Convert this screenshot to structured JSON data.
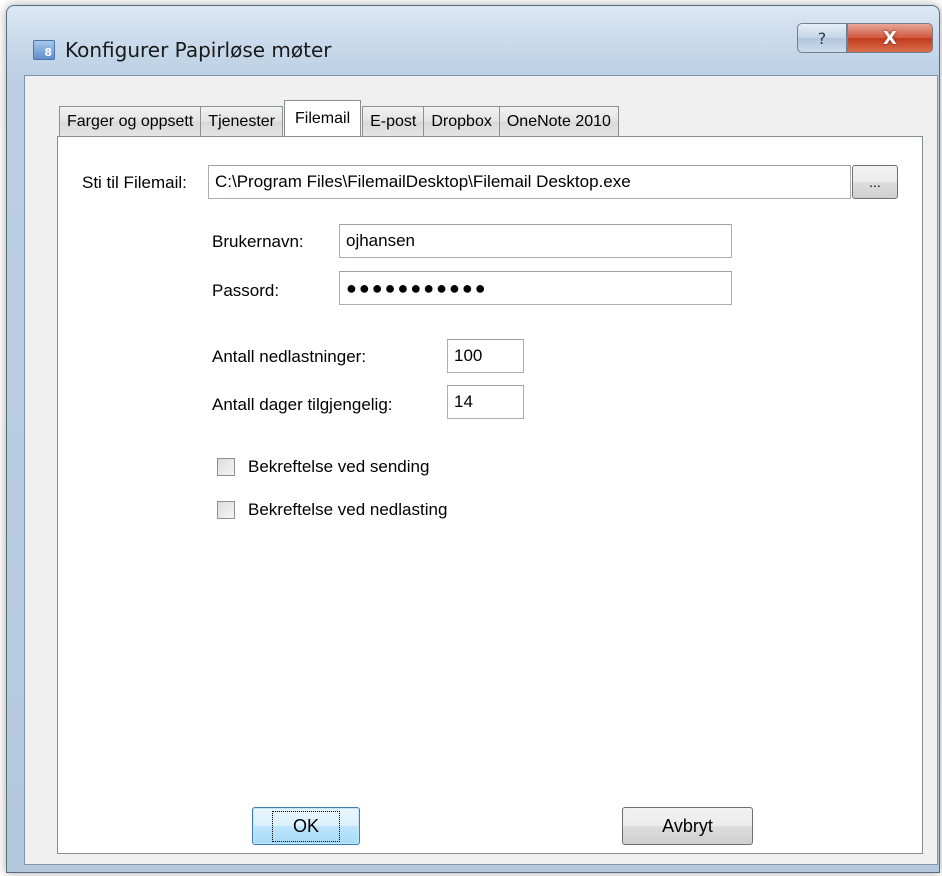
{
  "window": {
    "title": "Konfigurer Papirløse møter",
    "icon": "app-icon",
    "icon_glyph": "8",
    "help_glyph": "?",
    "close_glyph": "X"
  },
  "tabs": [
    {
      "label": "Farger og oppsett",
      "active": false
    },
    {
      "label": "Tjenester",
      "active": false
    },
    {
      "label": "Filemail",
      "active": true
    },
    {
      "label": "E-post",
      "active": false
    },
    {
      "label": "Dropbox",
      "active": false
    },
    {
      "label": "OneNote 2010",
      "active": false
    }
  ],
  "filemail": {
    "path_label": "Sti til Filemail:",
    "path_value": "C:\\Program Files\\FilemailDesktop\\Filemail Desktop.exe",
    "browse_label": "...",
    "username_label": "Brukernavn:",
    "username_value": "ojhansen",
    "password_label": "Passord:",
    "password_value": "●●●●●●●●●●●",
    "downloads_label": "Antall nedlastninger:",
    "downloads_value": "100",
    "days_label": "Antall dager tilgjengelig:",
    "days_value": "14",
    "confirm_send_label": "Bekreftelse ved sending",
    "confirm_send_checked": false,
    "confirm_download_label": "Bekreftelse ved nedlasting",
    "confirm_download_checked": false
  },
  "buttons": {
    "ok": "OK",
    "cancel": "Avbryt"
  }
}
